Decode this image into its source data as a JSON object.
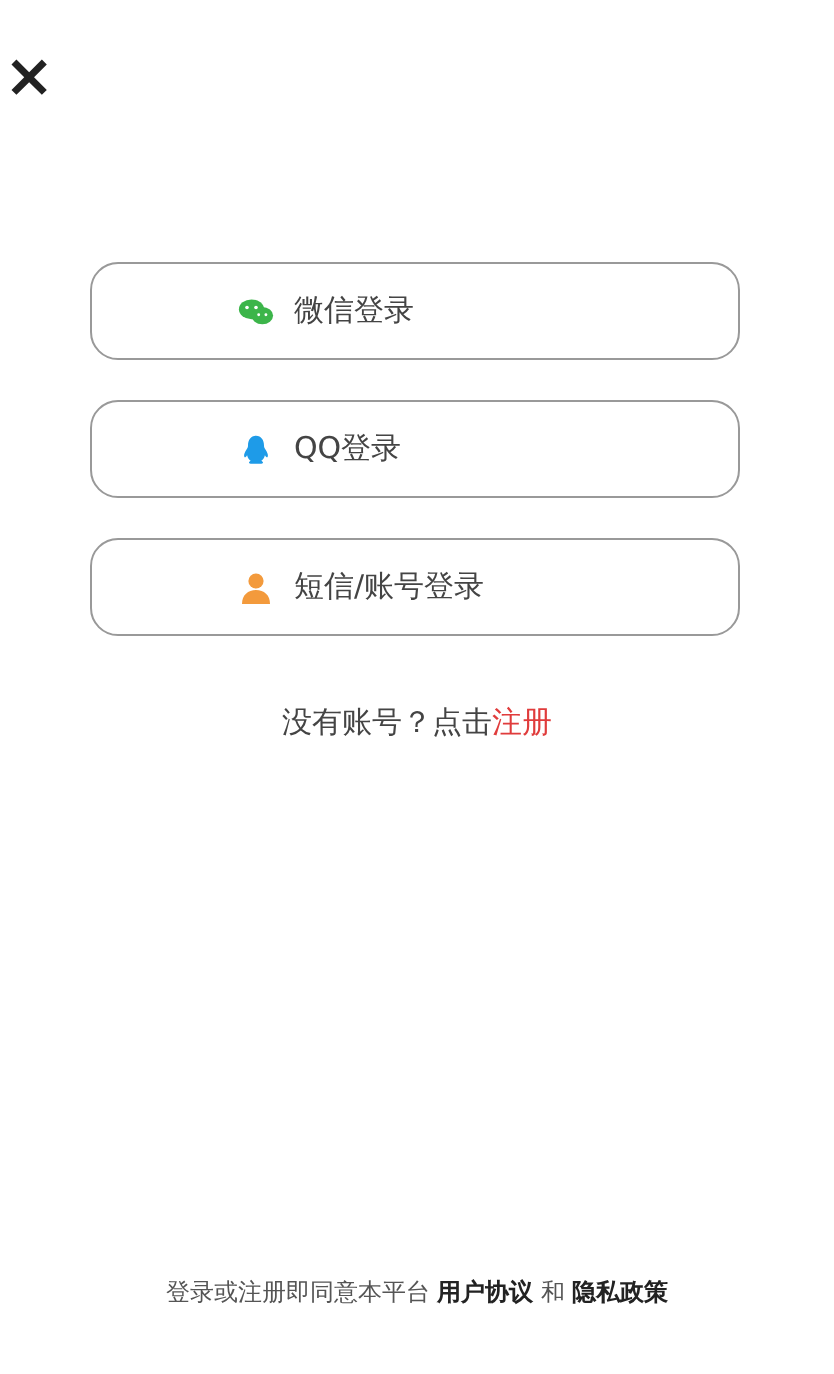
{
  "close": "×",
  "login_options": [
    {
      "kind": "wechat",
      "label": "微信登录"
    },
    {
      "kind": "qq",
      "label": "QQ登录"
    },
    {
      "kind": "account",
      "label": "短信/账号登录"
    }
  ],
  "register": {
    "prompt": "没有账号？点击",
    "link": "注册"
  },
  "agreement": {
    "prefix": "登录或注册即同意本平台",
    "terms": "用户协议",
    "joiner": "和",
    "privacy": "隐私政策"
  }
}
